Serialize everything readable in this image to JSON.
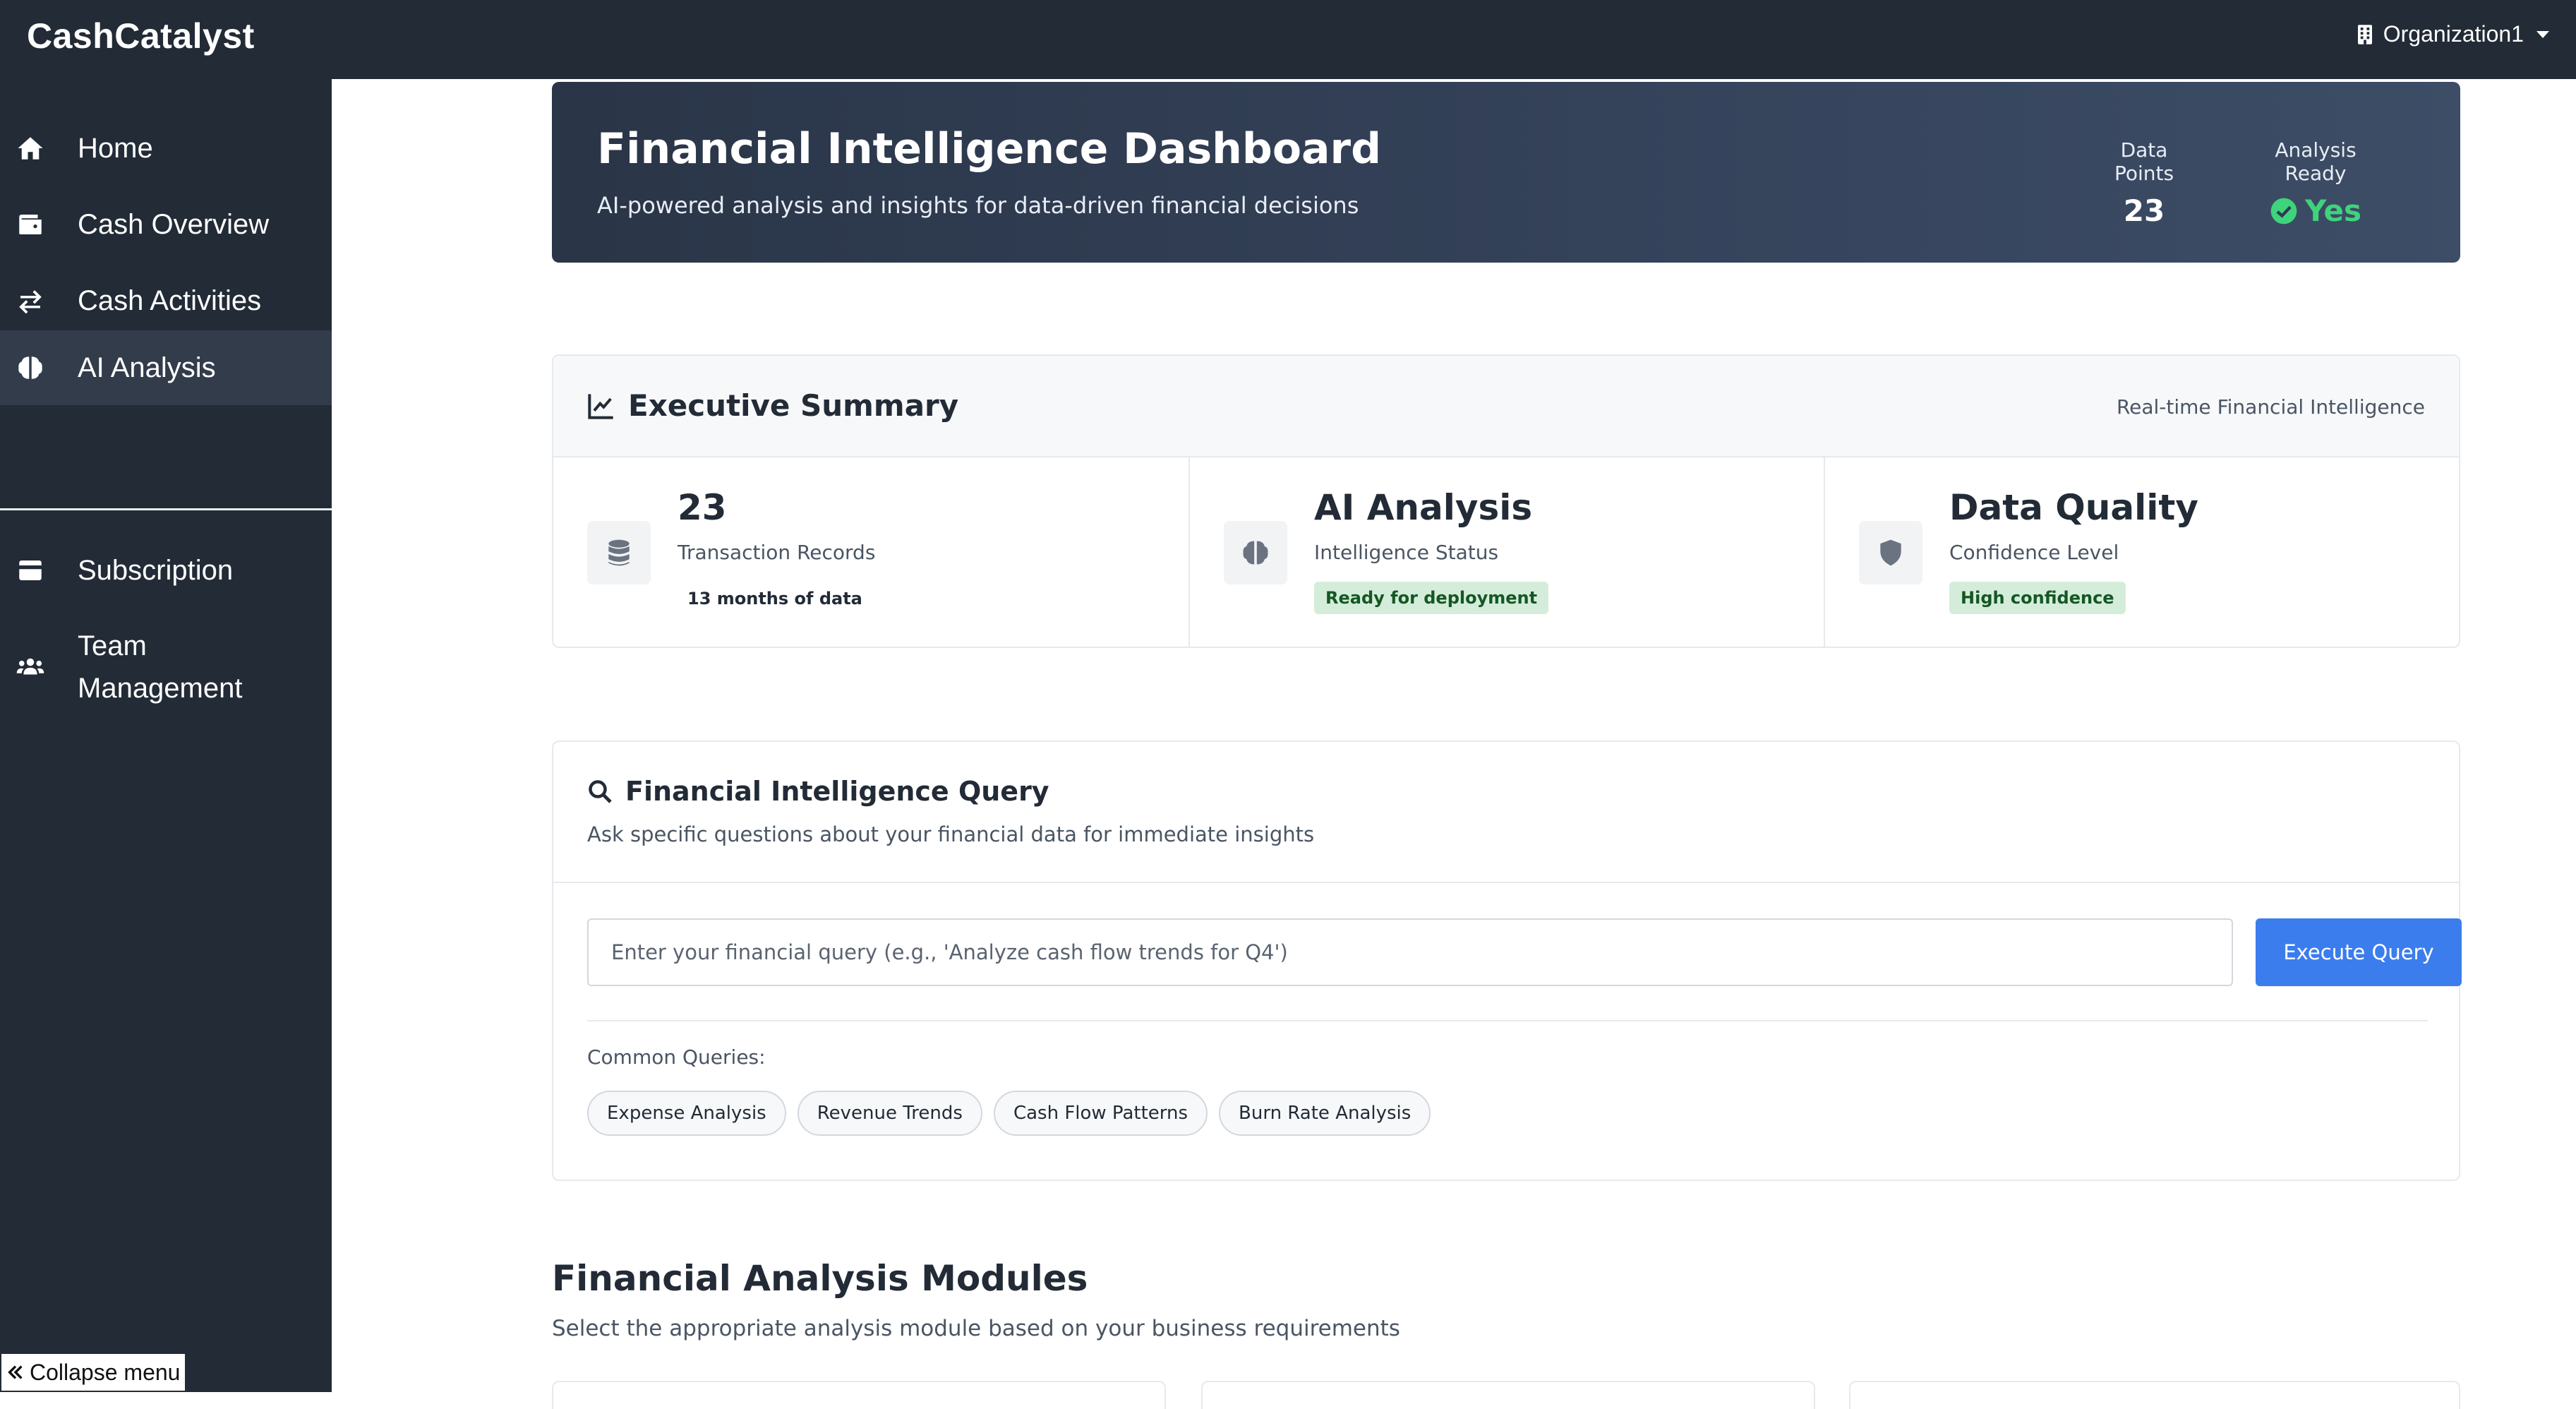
{
  "app": {
    "brand": "CashCatalyst",
    "organization": "Organization1"
  },
  "sidebar": {
    "items": [
      {
        "label": "Home",
        "icon": "home-icon"
      },
      {
        "label": "Cash Overview",
        "icon": "wallet-icon"
      },
      {
        "label": "Cash Activities",
        "icon": "exchange-arrows-icon"
      },
      {
        "label": "AI Analysis",
        "icon": "brain-icon",
        "active": true
      },
      {
        "label": "Subscription",
        "icon": "credit-card-icon"
      },
      {
        "label": "Team Management",
        "icon": "users-icon"
      }
    ],
    "collapse_label": "Collapse menu"
  },
  "hero": {
    "title": "Financial Intelligence Dashboard",
    "subtitle": "AI-powered analysis and insights for data-driven financial decisions",
    "stats": [
      {
        "label": "Data Points",
        "value": "23"
      },
      {
        "label": "Analysis Ready",
        "value": "Yes"
      }
    ]
  },
  "summary": {
    "title": "Executive Summary",
    "right_label": "Real-time Financial Intelligence",
    "metrics": [
      {
        "value": "23",
        "label": "Transaction Records",
        "note": "13 months of data",
        "icon": "database-icon"
      },
      {
        "value": "AI Analysis",
        "label": "Intelligence Status",
        "badge": "Ready for deployment",
        "icon": "brain-icon"
      },
      {
        "value": "Data Quality",
        "label": "Confidence Level",
        "badge": "High confidence",
        "icon": "shield-icon"
      }
    ]
  },
  "query": {
    "title": "Financial Intelligence Query",
    "subtitle": "Ask specific questions about your financial data for immediate insights",
    "input_placeholder": "Enter your financial query (e.g., 'Analyze cash flow trends for Q4')",
    "input_value": "",
    "execute_label": "Execute Query",
    "common_label": "Common Queries:",
    "chips": [
      "Expense Analysis",
      "Revenue Trends",
      "Cash Flow Patterns",
      "Burn Rate Analysis"
    ]
  },
  "modules": {
    "title": "Financial Analysis Modules",
    "subtitle": "Select the appropriate analysis module based on your business requirements"
  },
  "colors": {
    "sidebar_bg": "#222b36",
    "active_item_bg": "#323c4b",
    "accent_blue": "#3b7ded",
    "success_green": "#3fd37c",
    "badge_bg": "#d4edda",
    "badge_text": "#155724"
  }
}
